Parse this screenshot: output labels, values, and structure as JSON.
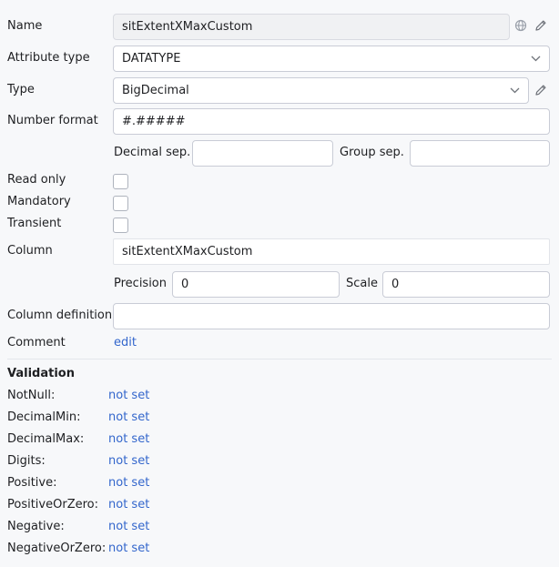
{
  "name": {
    "label": "Name",
    "value": "sitExtentXMaxCustom"
  },
  "attribute_type": {
    "label": "Attribute type",
    "value": "DATATYPE"
  },
  "type": {
    "label": "Type",
    "value": "BigDecimal"
  },
  "number_format": {
    "label": "Number format",
    "value": "#.#####",
    "decimal_sep_label": "Decimal sep.",
    "decimal_sep_value": "",
    "group_sep_label": "Group sep.",
    "group_sep_value": ""
  },
  "flags": {
    "read_only": {
      "label": "Read only",
      "checked": false
    },
    "mandatory": {
      "label": "Mandatory",
      "checked": false
    },
    "transient": {
      "label": "Transient",
      "checked": false
    }
  },
  "column": {
    "label": "Column",
    "value": "sitExtentXMaxCustom",
    "precision_label": "Precision",
    "precision_value": "0",
    "scale_label": "Scale",
    "scale_value": "0"
  },
  "column_definition": {
    "label": "Column definition",
    "value": ""
  },
  "comment": {
    "label": "Comment",
    "link": "edit"
  },
  "validation": {
    "title": "Validation",
    "items": [
      {
        "label": "NotNull:",
        "value": "not set"
      },
      {
        "label": "DecimalMin:",
        "value": "not set"
      },
      {
        "label": "DecimalMax:",
        "value": "not set"
      },
      {
        "label": "Digits:",
        "value": "not set"
      },
      {
        "label": "Positive:",
        "value": "not set"
      },
      {
        "label": "PositiveOrZero:",
        "value": "not set"
      },
      {
        "label": "Negative:",
        "value": "not set"
      },
      {
        "label": "NegativeOrZero:",
        "value": "not set"
      }
    ]
  },
  "icons": {
    "name_globe": "globe-icon",
    "name_edit": "pencil-icon",
    "type_edit": "pencil-icon",
    "dropdown": "chevron-down-icon"
  },
  "colors": {
    "link": "#3366cc",
    "background": "#f7f8fa"
  }
}
